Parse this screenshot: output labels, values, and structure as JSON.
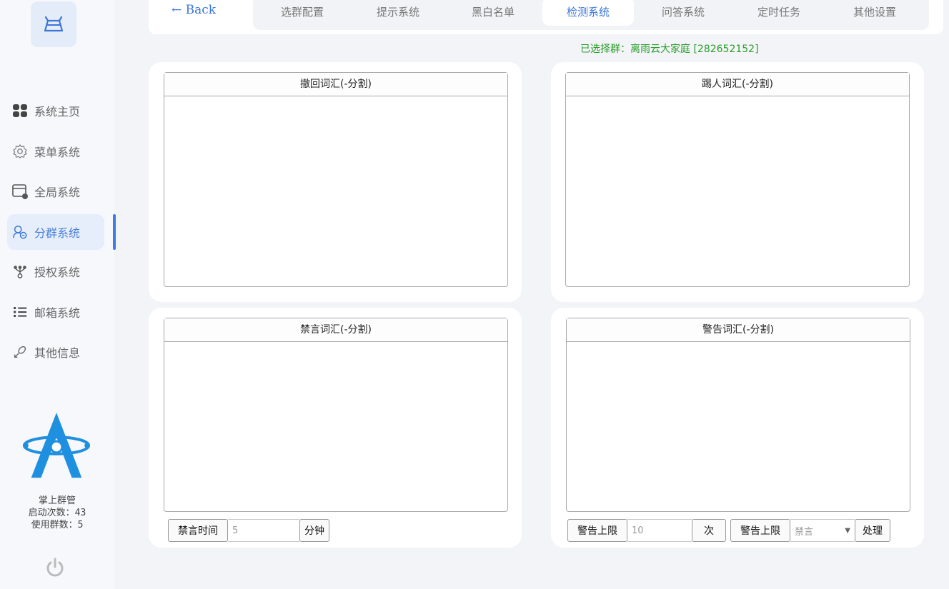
{
  "sidebar": {
    "items": [
      {
        "label": "系统主页",
        "icon": "grid-icon"
      },
      {
        "label": "菜单系统",
        "icon": "gear-icon"
      },
      {
        "label": "全局系统",
        "icon": "window-icon"
      },
      {
        "label": "分群系统",
        "icon": "group-icon",
        "active": true
      },
      {
        "label": "授权系统",
        "icon": "branch-icon"
      },
      {
        "label": "邮箱系统",
        "icon": "list-icon"
      },
      {
        "label": "其他信息",
        "icon": "link-icon"
      }
    ],
    "brand_name": "掌上群管",
    "launch_count": "启动次数：43",
    "group_count": "使用群数：5",
    "accent_color": "#3e7ce6"
  },
  "header": {
    "back_label": "← Back",
    "tabs": [
      {
        "label": "选群配置"
      },
      {
        "label": "提示系统"
      },
      {
        "label": "黑白名单"
      },
      {
        "label": "检测系统",
        "active": true
      },
      {
        "label": "问答系统"
      },
      {
        "label": "定时任务"
      },
      {
        "label": "其他设置"
      }
    ]
  },
  "selected_group": "已选择群：离雨云大家庭 [282652152]",
  "panels": {
    "recall_words": {
      "title": "撤回词汇(-分割)",
      "value": ""
    },
    "kick_words": {
      "title": "踢人词汇(-分割)",
      "value": ""
    },
    "mute_words": {
      "title": "禁言词汇(-分割)",
      "value": ""
    },
    "warn_words": {
      "title": "警告词汇(-分割)",
      "value": ""
    }
  },
  "mute_controls": {
    "time_label": "禁言时间",
    "time_value": "5",
    "unit_label": "分钟"
  },
  "warn_controls": {
    "limit_label": "警告上限",
    "limit_value": "10",
    "limit_unit": "次",
    "action_label": "警告上限",
    "action_value": "禁言",
    "process_label": "处理"
  }
}
